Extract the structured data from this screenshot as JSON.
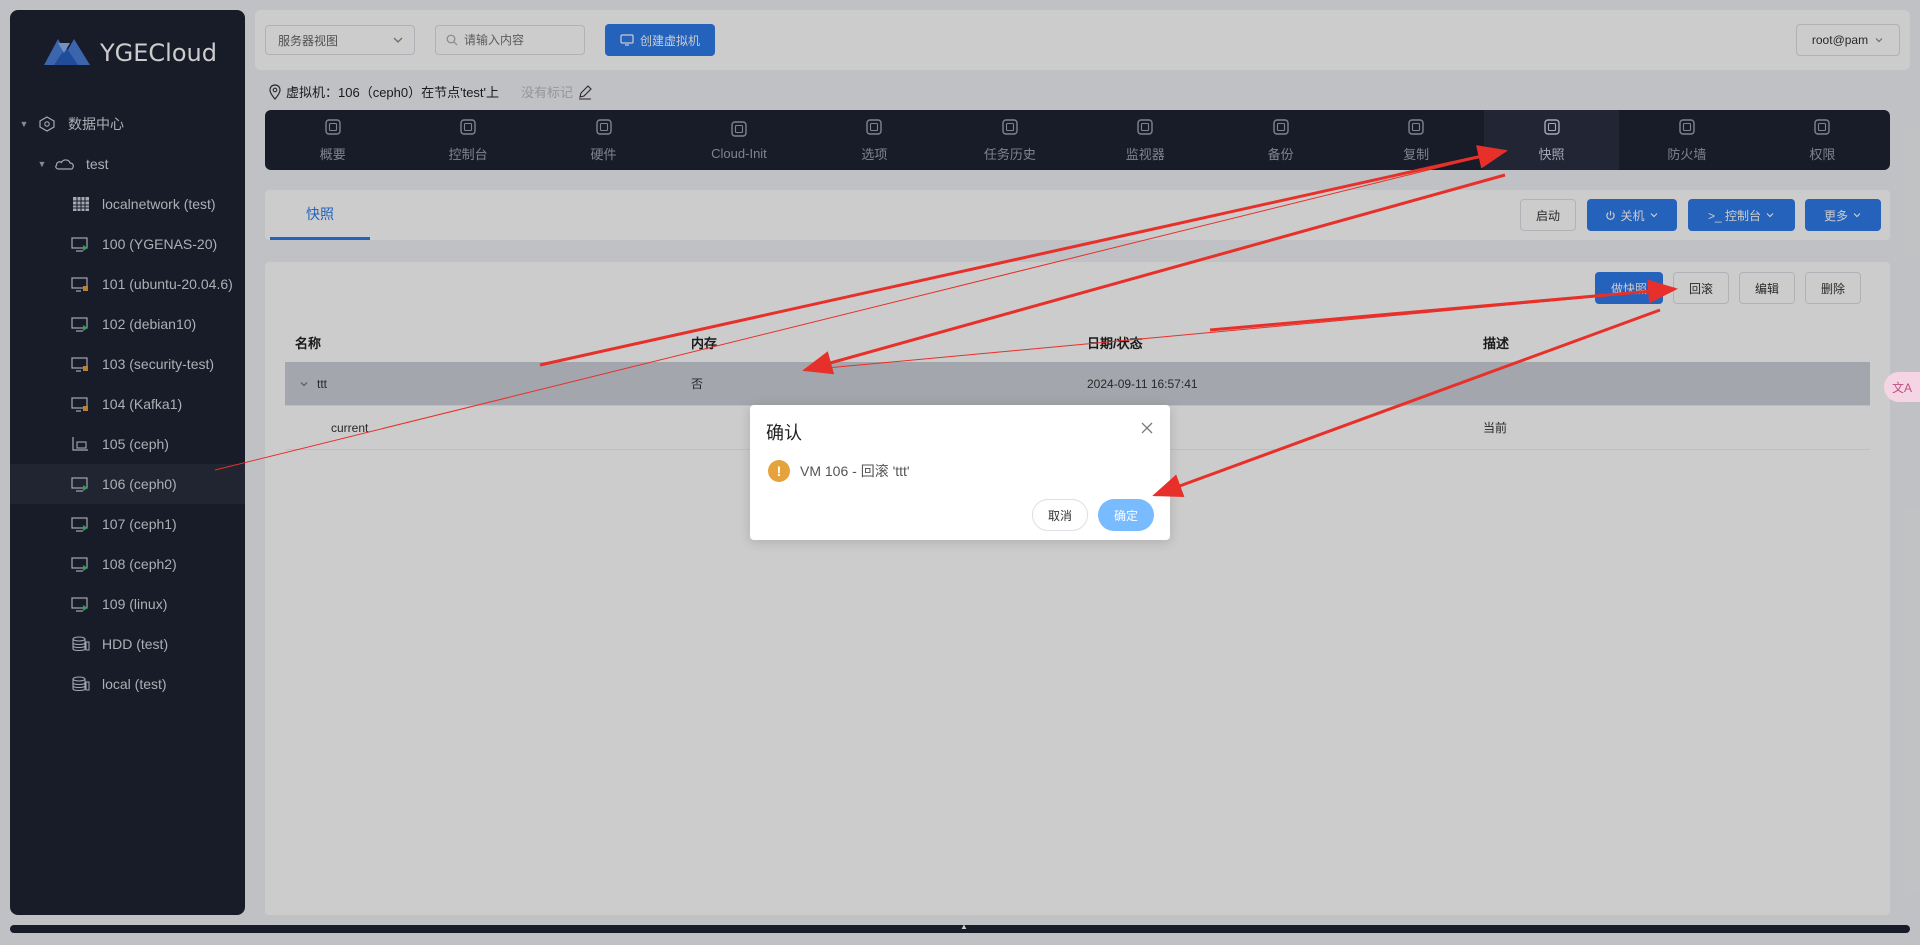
{
  "app": {
    "logo_text": "YGECloud"
  },
  "sidebar": {
    "items": [
      {
        "label": "数据中心",
        "icon": "datacenter-icon",
        "level": 0
      },
      {
        "label": "test",
        "icon": "cloud-node-icon",
        "level": 1
      },
      {
        "label": "localnetwork (test)",
        "icon": "grid-network-icon",
        "level": 2
      },
      {
        "label": "100 (YGENAS-20)",
        "icon": "vm-running-icon",
        "level": 2
      },
      {
        "label": "101 (ubuntu-20.04.6)",
        "icon": "vm-stopped-icon",
        "level": 2
      },
      {
        "label": "102 (debian10)",
        "icon": "vm-running-icon",
        "level": 2
      },
      {
        "label": "103 (security-test)",
        "icon": "vm-stopped-icon",
        "level": 2
      },
      {
        "label": "104 (Kafka1)",
        "icon": "vm-stopped-icon",
        "level": 2
      },
      {
        "label": "105 (ceph)",
        "icon": "template-icon",
        "level": 2
      },
      {
        "label": "106 (ceph0)",
        "icon": "vm-running-icon",
        "level": 2,
        "selected": true
      },
      {
        "label": "107 (ceph1)",
        "icon": "vm-running-icon",
        "level": 2
      },
      {
        "label": "108 (ceph2)",
        "icon": "vm-running-icon",
        "level": 2
      },
      {
        "label": "109 (linux)",
        "icon": "vm-running-icon",
        "level": 2
      },
      {
        "label": "HDD (test)",
        "icon": "storage-icon",
        "level": 2
      },
      {
        "label": "local (test)",
        "icon": "storage-icon",
        "level": 2
      }
    ]
  },
  "topbar": {
    "view_select": "服务器视图",
    "search_placeholder": "请输入内容",
    "create_vm": "创建虚拟机",
    "user": "root@pam"
  },
  "vm_info": {
    "text": "虚拟机：106（ceph0）在节点'test'上",
    "note": "没有标记"
  },
  "toolbar": {
    "tabs": [
      {
        "label": "概要",
        "icon": "summary-icon"
      },
      {
        "label": "控制台",
        "icon": "console-icon"
      },
      {
        "label": "硬件",
        "icon": "hardware-icon"
      },
      {
        "label": "Cloud-Init",
        "icon": "cloud-init-icon"
      },
      {
        "label": "选项",
        "icon": "options-icon"
      },
      {
        "label": "任务历史",
        "icon": "history-icon"
      },
      {
        "label": "监视器",
        "icon": "monitor-icon"
      },
      {
        "label": "备份",
        "icon": "backup-icon"
      },
      {
        "label": "复制",
        "icon": "replication-icon"
      },
      {
        "label": "快照",
        "icon": "snapshot-icon",
        "active": true
      },
      {
        "label": "防火墙",
        "icon": "firewall-icon"
      },
      {
        "label": "权限",
        "icon": "permission-icon"
      }
    ]
  },
  "panel": {
    "subtab": "快照",
    "start": "启动",
    "shutdown": "关机",
    "console": ">_ 控制台",
    "more": "更多"
  },
  "snapshots": {
    "buttons": {
      "take": "做快照",
      "rollback": "回滚",
      "edit": "编辑",
      "delete": "删除"
    },
    "columns": [
      "名称",
      "内存",
      "日期/状态",
      "描述"
    ],
    "rows": [
      {
        "name": "ttt",
        "ram": "否",
        "date": "2024-09-11 16:57:41",
        "desc": ""
      },
      {
        "name": "current",
        "ram": "",
        "date": "",
        "desc": "当前"
      }
    ]
  },
  "dialog": {
    "title": "确认",
    "message": "VM 106 - 回滚 'ttt'",
    "cancel": "取消",
    "ok": "确定"
  },
  "colors": {
    "accent": "#2f7bea",
    "sidebar": "#1e2232",
    "warning": "#e6a23c",
    "annotation": "#e8302a"
  }
}
